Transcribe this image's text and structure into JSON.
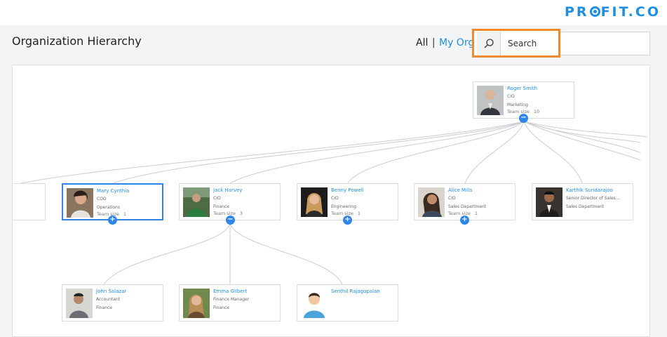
{
  "brand": {
    "logo_prefix": "PR",
    "logo_suffix": "FIT.CO"
  },
  "header": {
    "title": "Organization Hierarchy"
  },
  "filter": {
    "all": "All",
    "separator": "|",
    "my_org": "My Org"
  },
  "search": {
    "placeholder": "Search"
  },
  "team_label": "Team size",
  "root": {
    "name": "Roger Smith",
    "role": "CIO",
    "dept": "Marketing",
    "team": "10"
  },
  "level1": [
    {
      "name": "Mary Cynthia",
      "role": "COO",
      "dept": "Operations",
      "team": "1"
    },
    {
      "name": "Jack Harvey",
      "role": "CIO",
      "dept": "Finance",
      "team": "3"
    },
    {
      "name": "Benny Powell",
      "role": "CIO",
      "dept": "Engineering",
      "team": "1"
    },
    {
      "name": "Alice Mills",
      "role": "CIO",
      "dept": "Sales Department",
      "team": "1"
    },
    {
      "name": "Karthik Sundarajoo",
      "role": "Senior Director of Sales...",
      "dept": "Sales Department",
      "team": ""
    }
  ],
  "level2": [
    {
      "name": "John Salazar",
      "role": "Accountant",
      "dept": "Finance"
    },
    {
      "name": "Emma Gilbert",
      "role": "Finance Manager",
      "dept": "Finance"
    },
    {
      "name": "Senthil Rajagopalan",
      "role": "",
      "dept": ""
    }
  ],
  "toggles": {
    "expand": "+",
    "collapse": "−"
  },
  "colors": {
    "accent": "#2f86e8",
    "highlight": "#f28a2b",
    "link": "#1f8fe0"
  }
}
